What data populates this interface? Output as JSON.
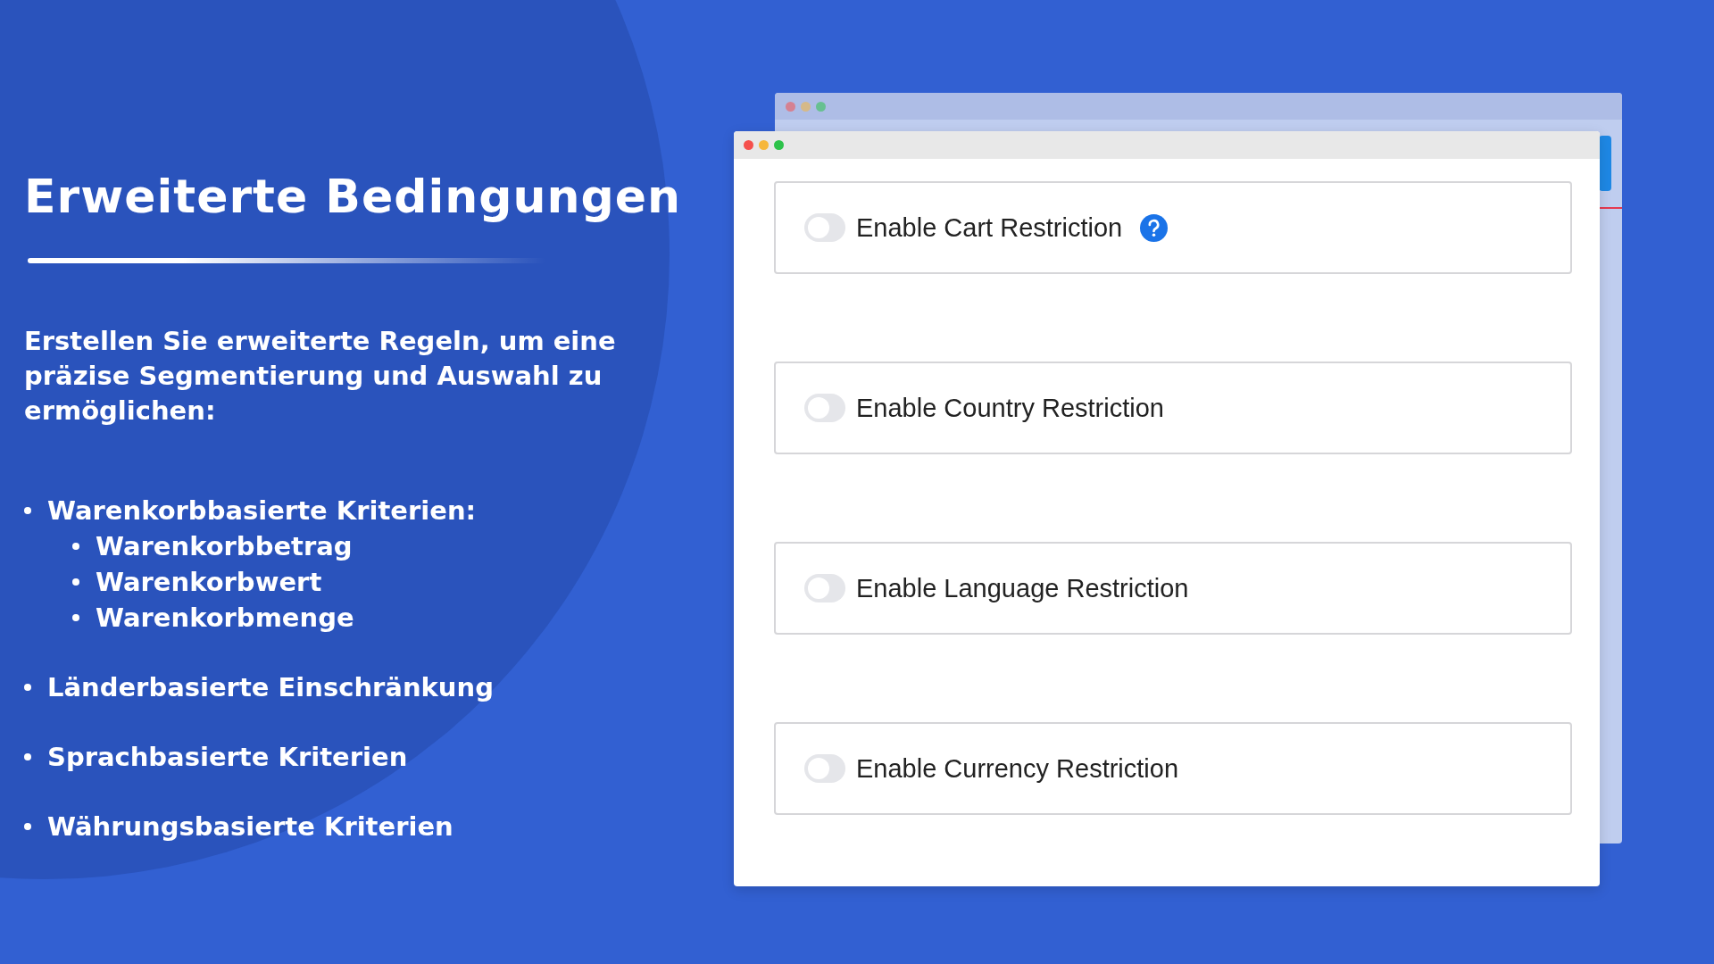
{
  "title": "Erweiterte Bedingungen",
  "intro": "Erstellen Sie erweiterte Regeln, um eine präzise Segmentierung und Auswahl zu ermöglichen:",
  "bullets": [
    {
      "text": "Warenkorbbasierte Kriterien:",
      "children": [
        {
          "text": "Warenkorbbetrag"
        },
        {
          "text": "Warenkorbwert"
        },
        {
          "text": "Warenkorbmenge"
        }
      ]
    },
    {
      "text": "Länderbasierte Einschränkung"
    },
    {
      "text": "Sprachbasierte Kriterien"
    },
    {
      "text": "Währungsbasierte Kriterien"
    }
  ],
  "settings": [
    {
      "label": "Enable Cart Restriction",
      "on": false,
      "help": true
    },
    {
      "label": "Enable Country Restriction",
      "on": false,
      "help": false
    },
    {
      "label": "Enable Language Restriction",
      "on": false,
      "help": false
    },
    {
      "label": "Enable Currency Restriction",
      "on": false,
      "help": false
    }
  ]
}
